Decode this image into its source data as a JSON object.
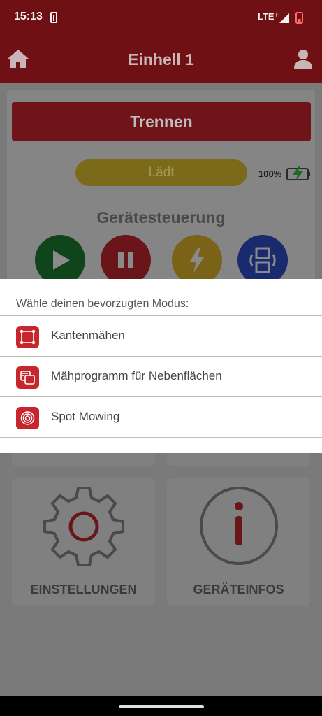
{
  "status_bar": {
    "time": "15:13",
    "network": "LTE⁺"
  },
  "app_bar": {
    "title": "Einhell 1",
    "home_icon": "home-icon",
    "user_icon": "user-icon"
  },
  "main": {
    "disconnect_label": "Trennen",
    "charging_status": "Lädt",
    "battery_percent": "100%",
    "section_title": "Gerätesteuerung",
    "controls": [
      {
        "name": "play",
        "icon": "play-icon",
        "color": "#1e7a2e"
      },
      {
        "name": "pause",
        "icon": "pause-icon",
        "color": "#c8262d"
      },
      {
        "name": "flash",
        "icon": "lightning-icon",
        "color": "#e0b52a"
      },
      {
        "name": "mode",
        "icon": "mode-switch-icon",
        "color": "#2f4fd0"
      }
    ]
  },
  "tiles": [
    {
      "label": "EINSTELLUNGEN",
      "icon": "gear-icon"
    },
    {
      "label": "GERÄTEINFOS",
      "icon": "info-icon"
    }
  ],
  "mode_sheet": {
    "title": "Wähle deinen bevorzugten Modus:",
    "items": [
      {
        "label": "Kantenmähen",
        "icon": "edge-mowing-icon"
      },
      {
        "label": "Mähprogramm für Nebenflächen",
        "icon": "secondary-area-icon"
      },
      {
        "label": "Spot Mowing",
        "icon": "spiral-icon"
      }
    ]
  },
  "colors": {
    "brand_red": "#c8262d",
    "appbar": "#6e1014",
    "sheet_bg": "#ffffff"
  }
}
